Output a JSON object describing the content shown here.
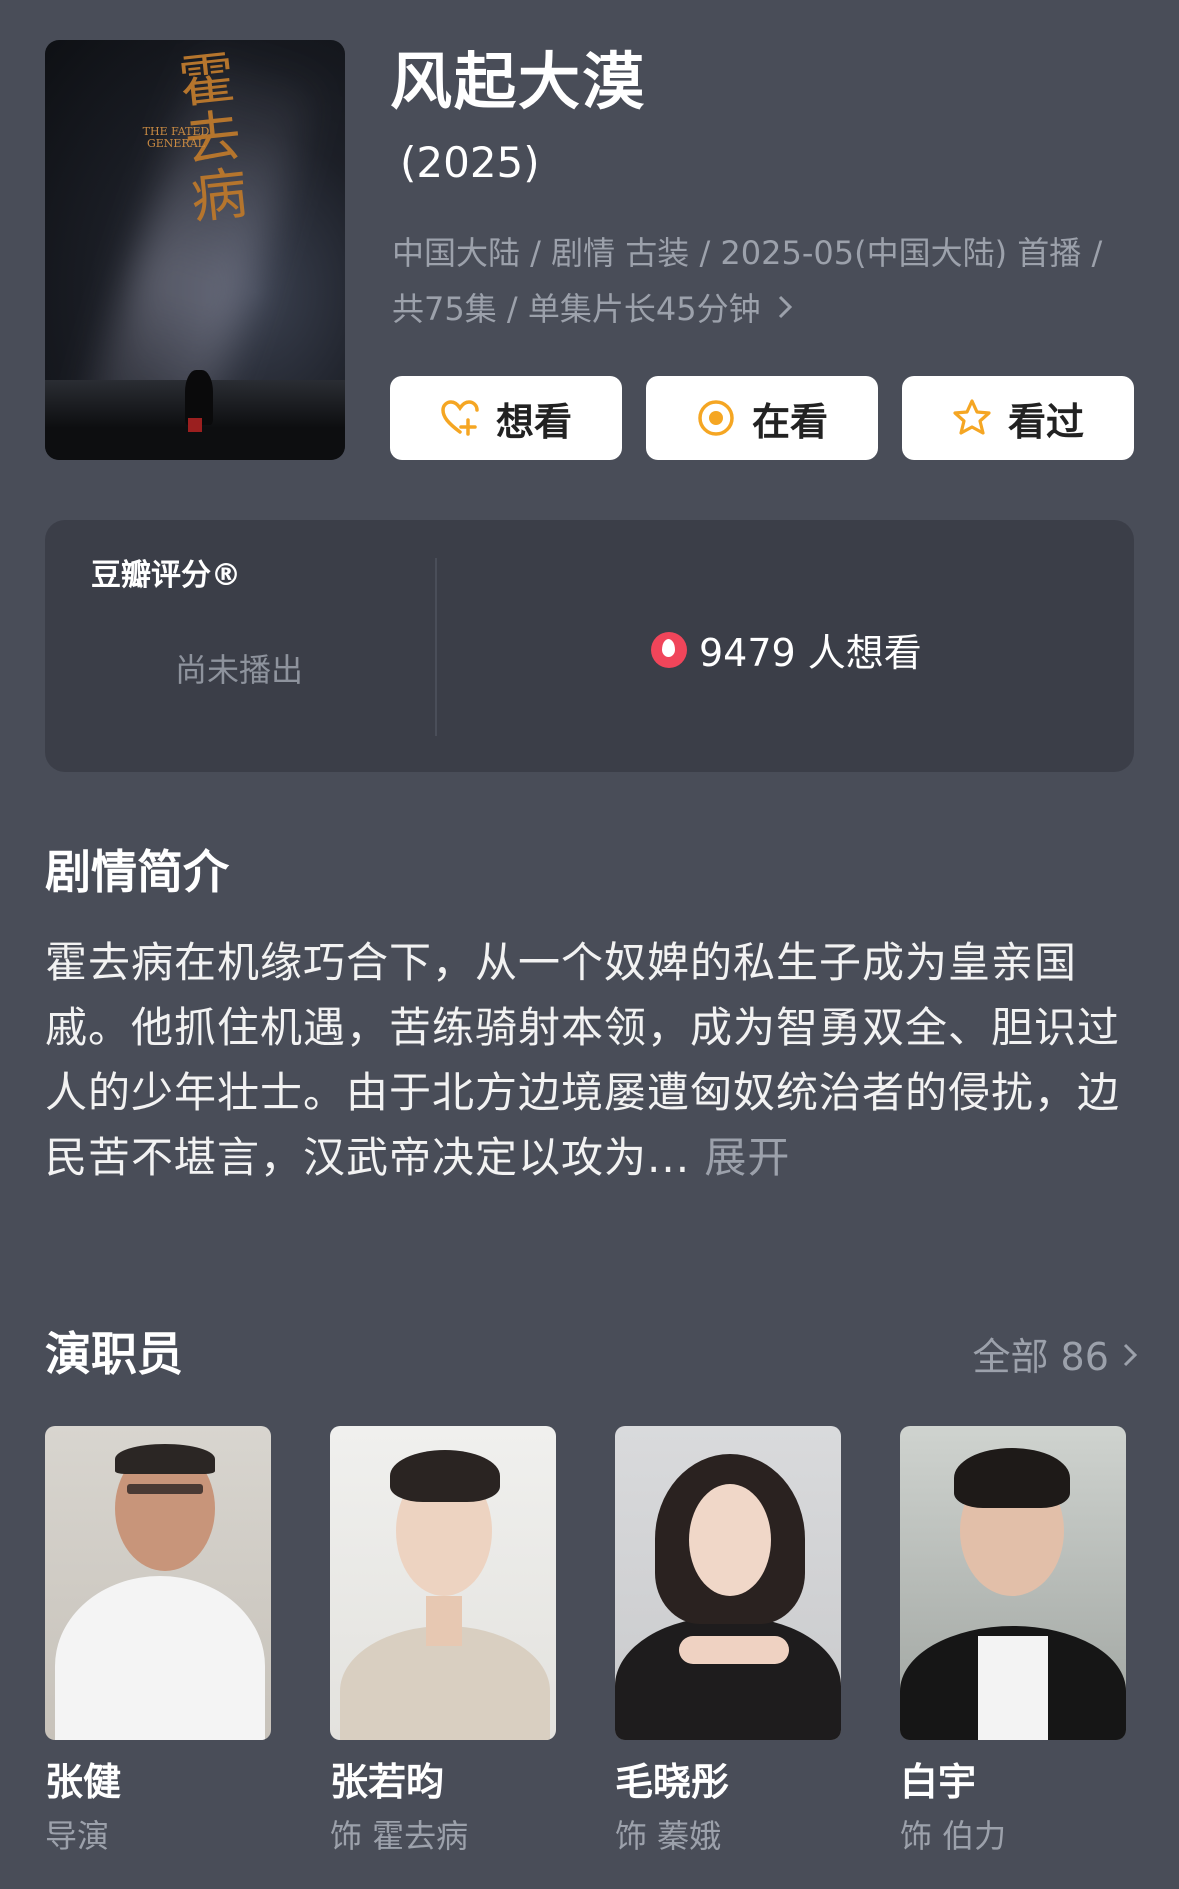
{
  "poster": {
    "title_art": "霍去病",
    "title_en": "THE FATED GENERAL"
  },
  "show": {
    "title": "风起大漠",
    "year": "(2025)",
    "meta_line1": "中国大陆 / 剧情 古装 / 2025-05(中国大陆) 首播 /",
    "meta_line2": "共75集 / 单集片长45分钟"
  },
  "actions": {
    "want": "想看",
    "watching": "在看",
    "watched": "看过"
  },
  "rating": {
    "label": "豆瓣评分®",
    "status": "尚未播出",
    "want_count": "9479 人想看"
  },
  "synopsis": {
    "title": "剧情简介",
    "text": "霍去病在机缘巧合下，从一个奴婢的私生子成为皇亲国戚。他抓住机遇，苦练骑射本领，成为智勇双全、胆识过人的少年壮士。由于北方边境屡遭匈奴统治者的侵扰，边民苦不堪言，汉武帝决定以攻为...",
    "more": "展开"
  },
  "cast": {
    "title": "演职员",
    "all_label": "全部 86",
    "members": [
      {
        "name": "张健",
        "role": "导演"
      },
      {
        "name": "张若昀",
        "role": "饰 霍去病"
      },
      {
        "name": "毛晓彤",
        "role": "饰 蓁娥"
      },
      {
        "name": "白宇",
        "role": "饰 伯力"
      }
    ]
  },
  "colors": {
    "background": "#494d58",
    "card": "#3b3e48",
    "accent_orange": "#f5a623",
    "fire_red": "#f0455a"
  }
}
